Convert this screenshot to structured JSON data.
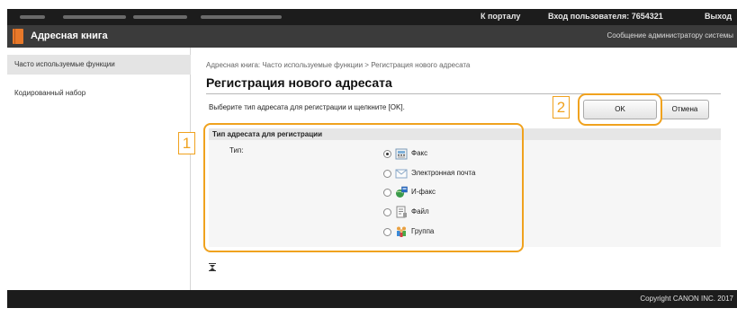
{
  "topbar": {
    "portal_link": "К порталу",
    "login_text": "Вход пользователя:  7654321",
    "logout_link": "Выход"
  },
  "titlebar": {
    "title": "Адресная книга",
    "admin_message": "Сообщение администратору системы"
  },
  "sidebar": {
    "items": [
      {
        "label": "Часто используемые функции",
        "active": true
      },
      {
        "label": "Кодированный набор",
        "active": false
      }
    ]
  },
  "main": {
    "breadcrumb": "Адресная книга: Часто используемые функции > Регистрация нового адресата",
    "page_title": "Регистрация нового адресата",
    "instruction": "Выберите тип адресата для регистрации и щелкните [OK].",
    "ok_label": "OK",
    "cancel_label": "Отмена",
    "section_title": "Тип адресата для регистрации",
    "type_label": "Тип:",
    "options": [
      {
        "label": "Факс",
        "icon": "fax-icon",
        "selected": true
      },
      {
        "label": "Электронная почта",
        "icon": "email-icon",
        "selected": false
      },
      {
        "label": "И-факс",
        "icon": "ifax-icon",
        "selected": false
      },
      {
        "label": "Файл",
        "icon": "file-icon",
        "selected": false
      },
      {
        "label": "Группа",
        "icon": "group-icon",
        "selected": false
      }
    ],
    "collapse_icon": "collapse-top-icon"
  },
  "callouts": {
    "first": "1",
    "second": "2",
    "color": "#f0a21e"
  },
  "footer": {
    "copyright": "Copyright CANON INC. 2017"
  }
}
